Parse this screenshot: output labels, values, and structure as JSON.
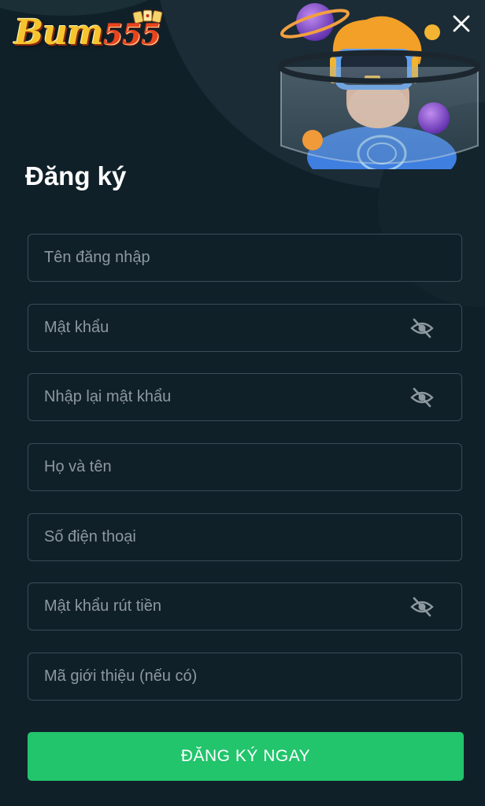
{
  "brand": {
    "logo_word": "Bum",
    "logo_number": "555"
  },
  "header": {
    "close_icon": "close-icon",
    "title": "Đăng ký"
  },
  "form": {
    "username": {
      "placeholder": "Tên đăng nhập",
      "value": ""
    },
    "password": {
      "placeholder": "Mật khẩu",
      "value": "",
      "toggle_icon": "eye-off-icon"
    },
    "confirm_password": {
      "placeholder": "Nhập lại mật khẩu",
      "value": "",
      "toggle_icon": "eye-off-icon"
    },
    "full_name": {
      "placeholder": "Họ và tên",
      "value": ""
    },
    "phone": {
      "placeholder": "Số điện thoại",
      "value": ""
    },
    "withdraw_password": {
      "placeholder": "Mật khẩu rút tiền",
      "value": "",
      "toggle_icon": "eye-off-icon"
    },
    "referral_code": {
      "placeholder": "Mã giới thiệu (nếu có)",
      "value": ""
    },
    "submit_label": "ĐĂNG KÝ NGAY"
  },
  "colors": {
    "background": "#102029",
    "field_border": "#3b4c57",
    "placeholder": "#8d989f",
    "accent_button": "#22c46c",
    "title": "#ffffff"
  }
}
